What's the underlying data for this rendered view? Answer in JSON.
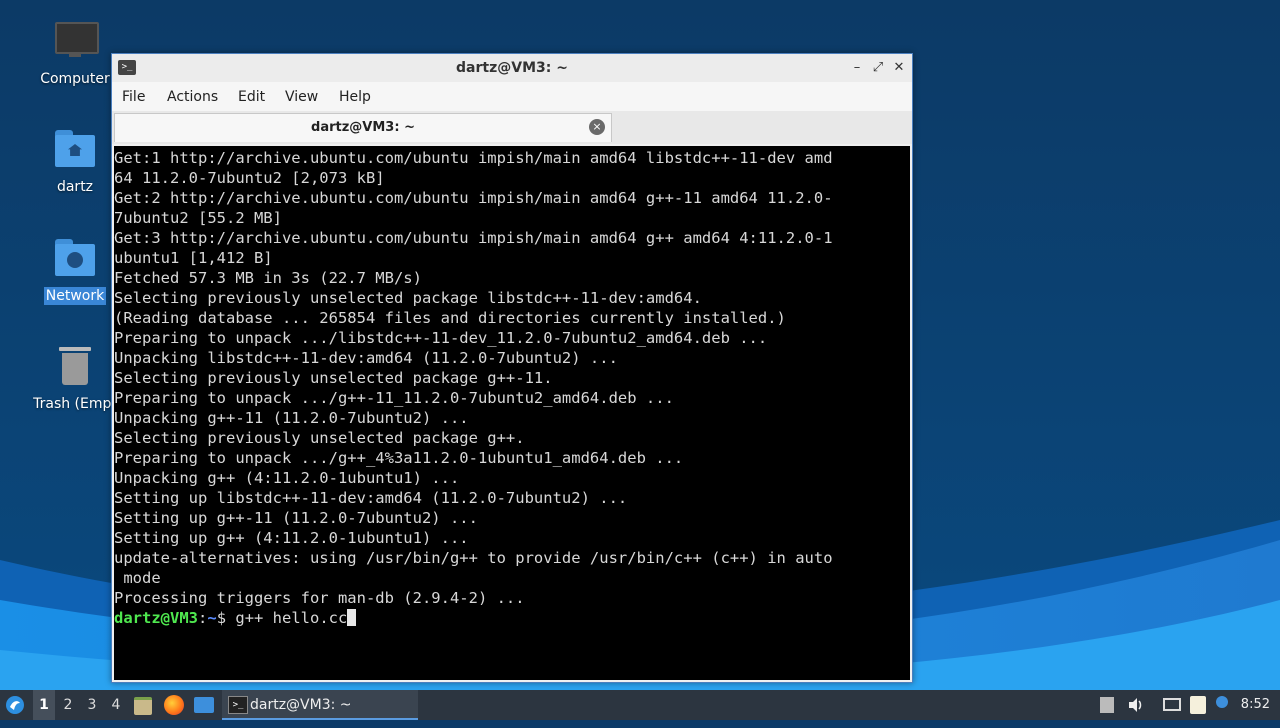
{
  "desktop": {
    "icons": [
      {
        "label": "Computer"
      },
      {
        "label": "dartz"
      },
      {
        "label": "Network"
      },
      {
        "label": "Trash (Empt"
      }
    ]
  },
  "window": {
    "title": "dartz@VM3: ~",
    "app_icon": ">_",
    "controls": {
      "minimize": "–",
      "maximize": "⤢",
      "close": "✕"
    },
    "menu": [
      "File",
      "Actions",
      "Edit",
      "View",
      "Help"
    ],
    "tab": {
      "label": "dartz@VM3: ~",
      "close": "×"
    }
  },
  "terminal": {
    "lines": [
      "Get:1 http://archive.ubuntu.com/ubuntu impish/main amd64 libstdc++-11-dev amd",
      "64 11.2.0-7ubuntu2 [2,073 kB]",
      "Get:2 http://archive.ubuntu.com/ubuntu impish/main amd64 g++-11 amd64 11.2.0-",
      "7ubuntu2 [55.2 MB]",
      "Get:3 http://archive.ubuntu.com/ubuntu impish/main amd64 g++ amd64 4:11.2.0-1",
      "ubuntu1 [1,412 B]",
      "Fetched 57.3 MB in 3s (22.7 MB/s)",
      "Selecting previously unselected package libstdc++-11-dev:amd64.",
      "(Reading database ... 265854 files and directories currently installed.)",
      "Preparing to unpack .../libstdc++-11-dev_11.2.0-7ubuntu2_amd64.deb ...",
      "Unpacking libstdc++-11-dev:amd64 (11.2.0-7ubuntu2) ...",
      "Selecting previously unselected package g++-11.",
      "Preparing to unpack .../g++-11_11.2.0-7ubuntu2_amd64.deb ...",
      "Unpacking g++-11 (11.2.0-7ubuntu2) ...",
      "Selecting previously unselected package g++.",
      "Preparing to unpack .../g++_4%3a11.2.0-1ubuntu1_amd64.deb ...",
      "Unpacking g++ (4:11.2.0-1ubuntu1) ...",
      "Setting up libstdc++-11-dev:amd64 (11.2.0-7ubuntu2) ...",
      "Setting up g++-11 (11.2.0-7ubuntu2) ...",
      "Setting up g++ (4:11.2.0-1ubuntu1) ...",
      "update-alternatives: using /usr/bin/g++ to provide /usr/bin/c++ (c++) in auto",
      " mode",
      "Processing triggers for man-db (2.9.4-2) ..."
    ],
    "prompt": {
      "user_host": "dartz@VM3",
      "sep": ":",
      "path": "~",
      "symbol": "$ ",
      "command": "g++ hello.cc"
    }
  },
  "taskbar": {
    "workspaces": [
      "1",
      "2",
      "3",
      "4"
    ],
    "active_workspace": "1",
    "task": {
      "label": "dartz@VM3: ~",
      "icon": ">_"
    },
    "clock": "8:52"
  },
  "colors": {
    "prompt_user": "#4fe84f",
    "prompt_path": "#5c8cff",
    "taskbar": "#2c3540"
  }
}
